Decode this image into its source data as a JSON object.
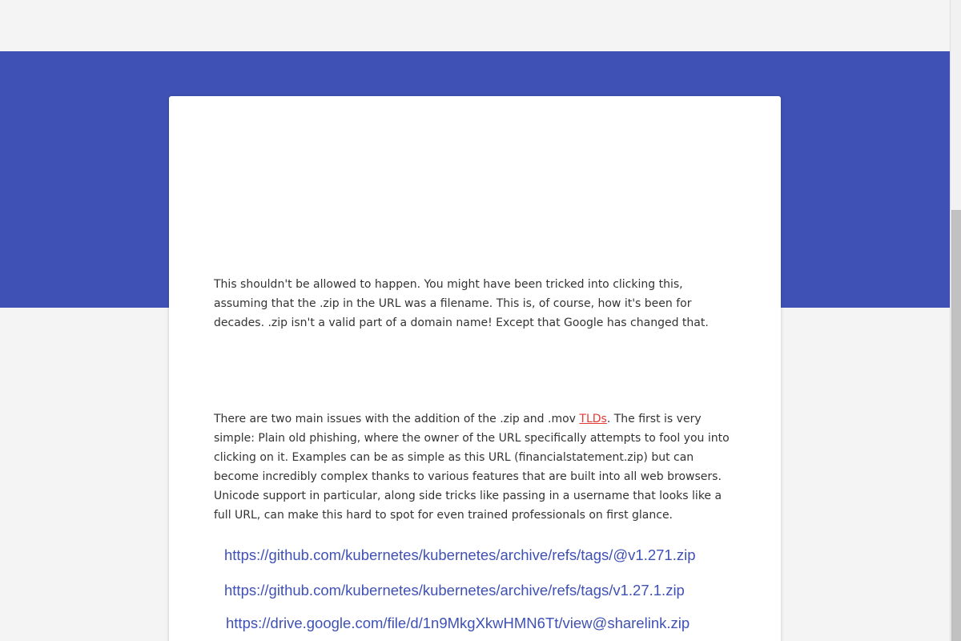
{
  "colors": {
    "accent": "#3f51b5",
    "link_red": "#e53935",
    "background": "#f4f4f4",
    "card": "#ffffff",
    "text": "#333333"
  },
  "article": {
    "paragraph_1": "This shouldn't be allowed to happen. You might have been tricked into clicking this, assuming that the .zip in the URL was a filename. This is, of course, how it's been for decades. .zip isn't a valid part of a domain name! Except that Google has changed that.",
    "paragraph_2_before": "There are two main issues with the addition of the .zip and .mov ",
    "paragraph_2_link": "TLDs",
    "paragraph_2_after": ". The first is very simple: Plain old phishing, where the owner of the URL specifically attempts to fool you into clicking on it. Examples can be as simple as this URL (financialstatement.zip) but can become incredibly complex thanks to various features that are built into all web browsers. Unicode support in particular, along side tricks like passing in a username that looks like a full URL, can make this hard to spot for even trained professionals on first glance.",
    "urls": [
      "https://github.com/kubernetes/kubernetes/archive/refs/tags/@v1.271.zip",
      "https://github.com/kubernetes/kubernetes/archive/refs/tags/v1.27.1.zip",
      "https://drive.google.com/file/d/1n9MkgXkwHMN6Tt/view@sharelink.zip"
    ]
  }
}
